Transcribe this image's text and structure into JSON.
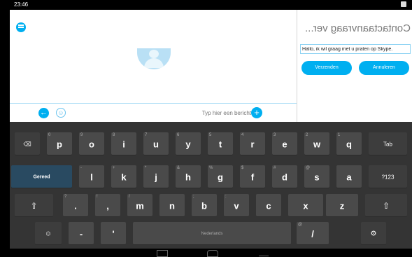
{
  "status_bar": {
    "time": "23:46"
  },
  "chat": {
    "input_placeholder": "Typ hier een bericht",
    "emoji_glyph": "☺",
    "send_glyph": "+",
    "back_glyph": "←"
  },
  "contact_request": {
    "title": "Contactaanvraag ver...",
    "message": "Hallo, ik wil graag met u praten op Skype.",
    "cancel_label": "Annuleren",
    "send_label": "Verzenden"
  },
  "keyboard": {
    "row1": [
      {
        "key": "⌫",
        "hint": ""
      },
      {
        "key": "p",
        "hint": "0"
      },
      {
        "key": "o",
        "hint": "9"
      },
      {
        "key": "i",
        "hint": "8"
      },
      {
        "key": "u",
        "hint": "7"
      },
      {
        "key": "y",
        "hint": "6"
      },
      {
        "key": "t",
        "hint": "5"
      },
      {
        "key": "r",
        "hint": "4"
      },
      {
        "key": "e",
        "hint": "3"
      },
      {
        "key": "w",
        "hint": "2"
      },
      {
        "key": "q",
        "hint": "1"
      },
      {
        "key": "Tab",
        "hint": ""
      }
    ],
    "row2": [
      {
        "key": "Gereed",
        "hint": ""
      },
      {
        "key": "l",
        "hint": "-"
      },
      {
        "key": "k",
        "hint": "+"
      },
      {
        "key": "j",
        "hint": "*"
      },
      {
        "key": "h",
        "hint": "&"
      },
      {
        "key": "g",
        "hint": "%"
      },
      {
        "key": "f",
        "hint": "$"
      },
      {
        "key": "d",
        "hint": "#"
      },
      {
        "key": "s",
        "hint": "@"
      },
      {
        "key": "a",
        "hint": ""
      },
      {
        "key": "?123",
        "hint": ""
      }
    ],
    "row3": [
      {
        "key": "⇧",
        "hint": ""
      },
      {
        "key": ".",
        "hint": "?"
      },
      {
        "key": ",",
        "hint": "!"
      },
      {
        "key": "m",
        "hint": "/"
      },
      {
        "key": "n",
        "hint": ""
      },
      {
        "key": "b",
        "hint": ";"
      },
      {
        "key": "v",
        "hint": ":"
      },
      {
        "key": "c",
        "hint": ""
      },
      {
        "key": "x",
        "hint": ""
      },
      {
        "key": "z",
        "hint": ""
      },
      {
        "key": "⇧",
        "hint": ""
      }
    ],
    "row4": [
      {
        "key": "☺",
        "hint": ""
      },
      {
        "key": "-",
        "hint": ""
      },
      {
        "key": "'",
        "hint": ""
      },
      {
        "key": "Nederlands",
        "hint": ""
      },
      {
        "key": "/",
        "hint": "@"
      },
      {
        "key": "⚙",
        "hint": ""
      }
    ]
  }
}
